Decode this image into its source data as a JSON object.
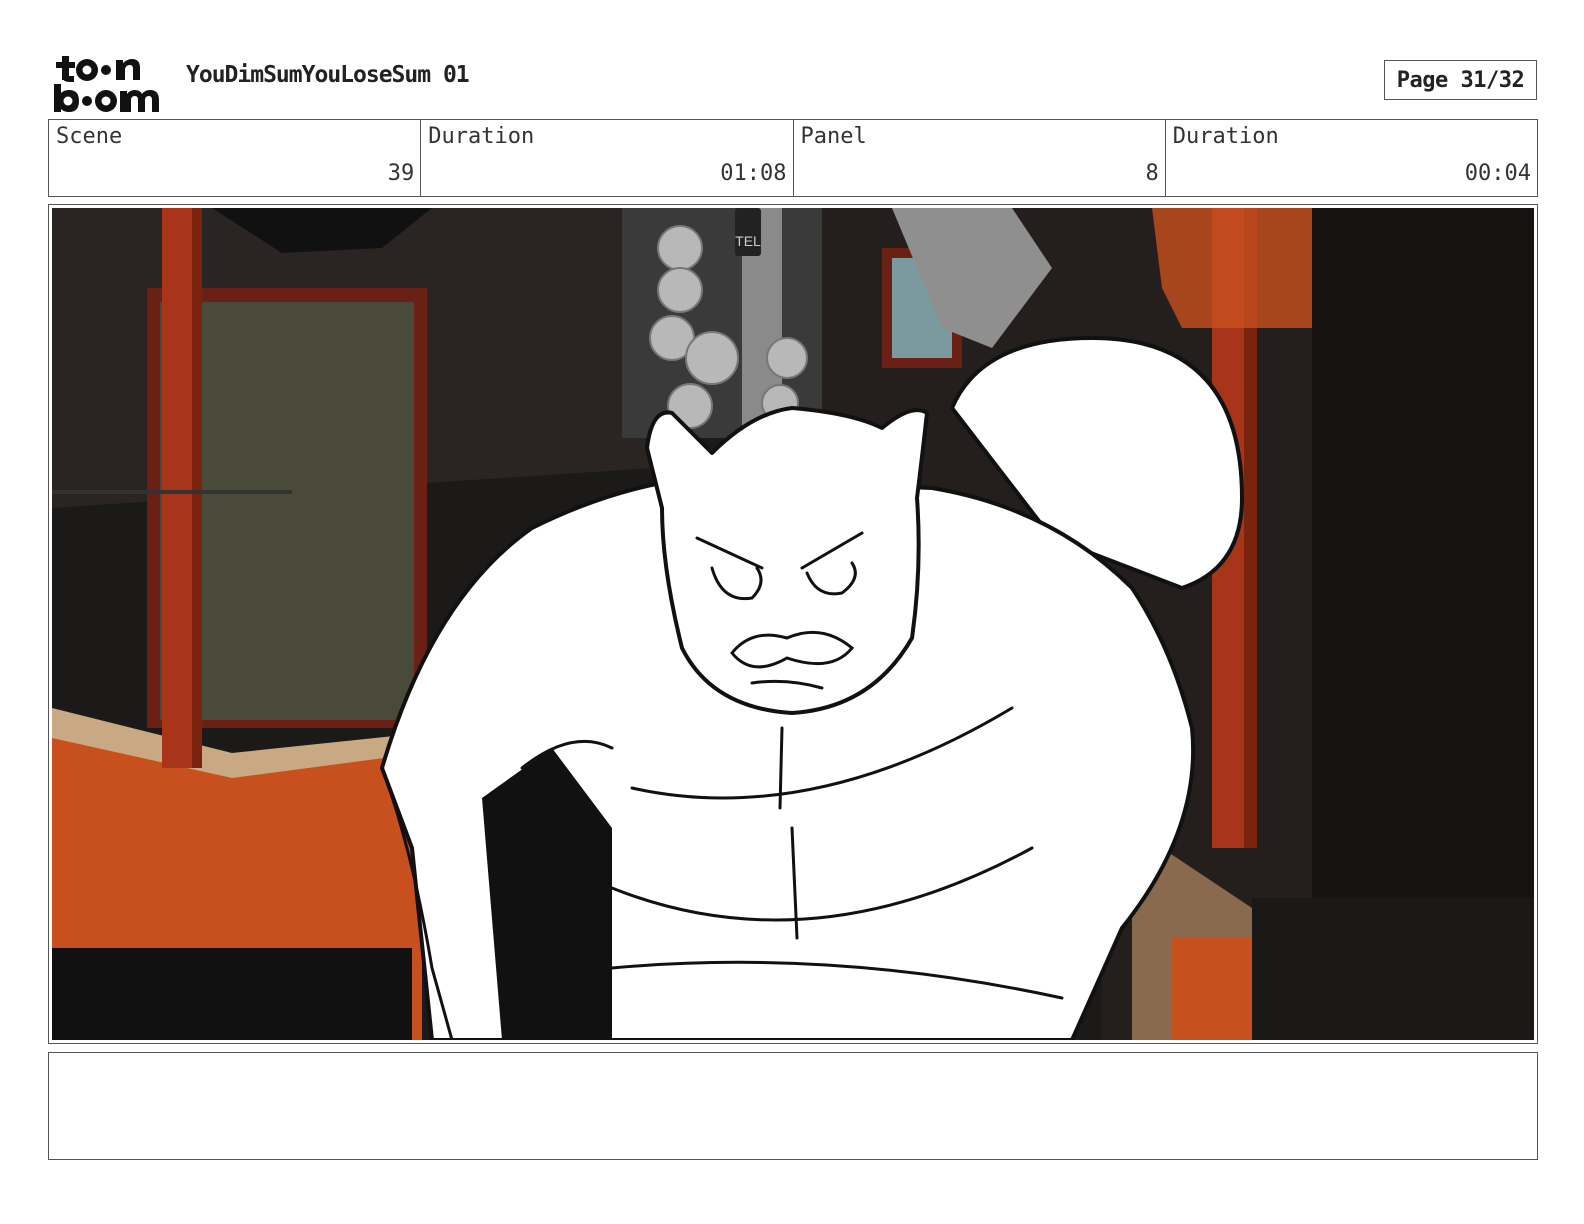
{
  "header": {
    "logo_text": "toon boom",
    "project_title": "YouDimSumYouLoseSum 01",
    "page_label": "Page 31/32"
  },
  "info": [
    {
      "label": "Scene",
      "value": "39"
    },
    {
      "label": "Duration",
      "value": "01:08"
    },
    {
      "label": "Panel",
      "value": "8"
    },
    {
      "label": "Duration",
      "value": "00:04"
    }
  ],
  "panel": {
    "sign_text": "TEL",
    "colors": {
      "wall_dark": "#1c1a18",
      "pillar_red": "#a8341a",
      "counter_orange": "#c8501e",
      "counter_top": "#c9a884",
      "door_green": "#4a4a3a",
      "sketch_line": "#111111",
      "figure_fill": "#ffffff"
    }
  },
  "notes": {
    "text": ""
  }
}
